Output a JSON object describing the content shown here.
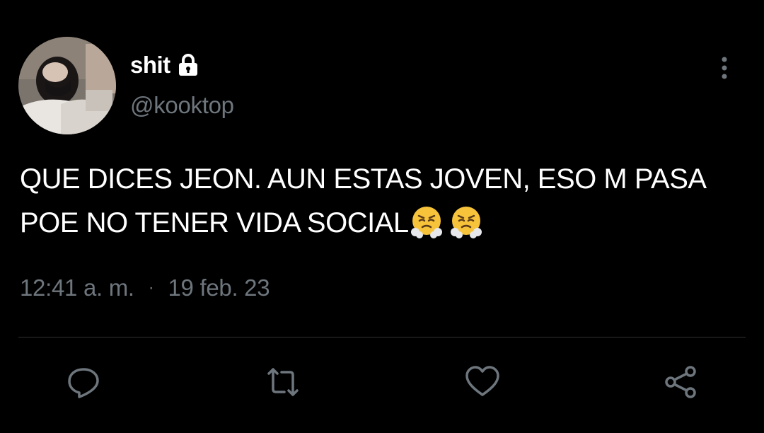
{
  "tweet": {
    "display_name": "shit",
    "handle": "@kooktop",
    "text": "QUE DICES JEON. AUN ESTAS JOVEN, ESO M PASA POE NO TENER VIDA SOCIAL",
    "emojis": [
      "face-with-steam-from-nose",
      "face-with-steam-from-nose"
    ],
    "time": "12:41 a. m.",
    "separator": "·",
    "date": "19 feb. 23"
  },
  "icons": {
    "lock": "lock-icon",
    "more": "more-vertical-icon",
    "reply": "reply-icon",
    "retweet": "retweet-icon",
    "like": "heart-icon",
    "share": "share-icon"
  },
  "colors": {
    "background": "#000000",
    "text": "#ffffff",
    "secondary": "#6e767d",
    "divider": "#2f3336"
  }
}
